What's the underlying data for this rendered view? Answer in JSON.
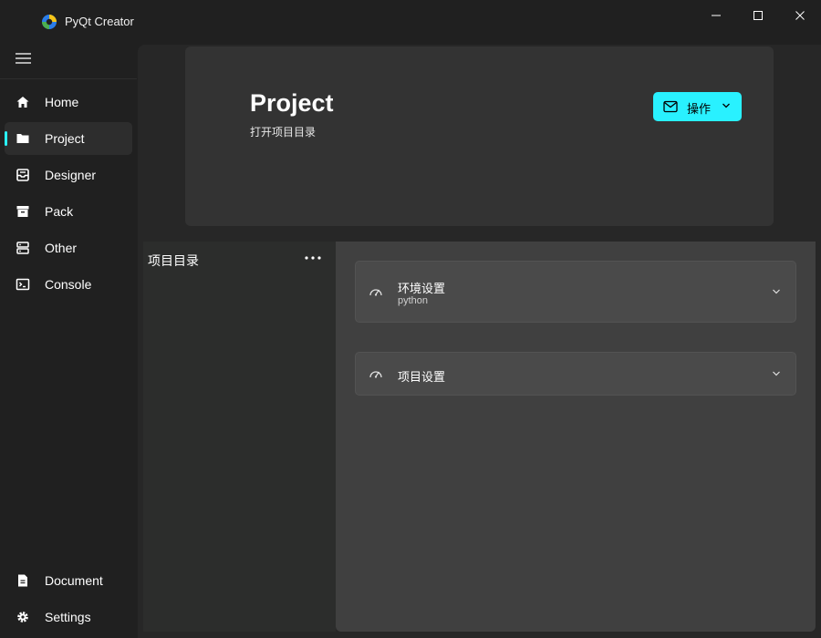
{
  "window": {
    "title": "PyQt Creator",
    "icons": {
      "logo": "pyqt-logo-icon",
      "minimize": "minimize-icon",
      "maximize": "maximize-icon",
      "close": "close-icon"
    }
  },
  "sidebar": {
    "menu_icon": "hamburger-menu-icon",
    "accent": "#29f1ff",
    "items": [
      {
        "label": "Home",
        "icon": "home-icon",
        "selected": false
      },
      {
        "label": "Project",
        "icon": "folder-icon",
        "selected": true
      },
      {
        "label": "Designer",
        "icon": "inbox-tray-icon",
        "selected": false
      },
      {
        "label": "Pack",
        "icon": "archive-box-icon",
        "selected": false
      },
      {
        "label": "Other",
        "icon": "server-icon",
        "selected": false
      },
      {
        "label": "Console",
        "icon": "terminal-icon",
        "selected": false
      }
    ],
    "bottom_items": [
      {
        "label": "Document",
        "icon": "document-icon"
      },
      {
        "label": "Settings",
        "icon": "gear-icon"
      }
    ]
  },
  "header": {
    "title": "Project",
    "subtitle": "打开项目目录",
    "action_button": {
      "label": "操作",
      "icon": "mail-icon",
      "dropdown_icon": "chevron-down-icon",
      "color": "#29f1ff"
    }
  },
  "project_tree": {
    "title": "项目目录",
    "more_icon": "more-horizontal-icon"
  },
  "settings": {
    "cards": [
      {
        "title": "环境设置",
        "subtitle": "python",
        "icon": "speedometer-icon",
        "expand_icon": "chevron-down-icon"
      },
      {
        "title": "项目设置",
        "subtitle": "",
        "icon": "speedometer-icon",
        "expand_icon": "chevron-down-icon"
      }
    ]
  }
}
